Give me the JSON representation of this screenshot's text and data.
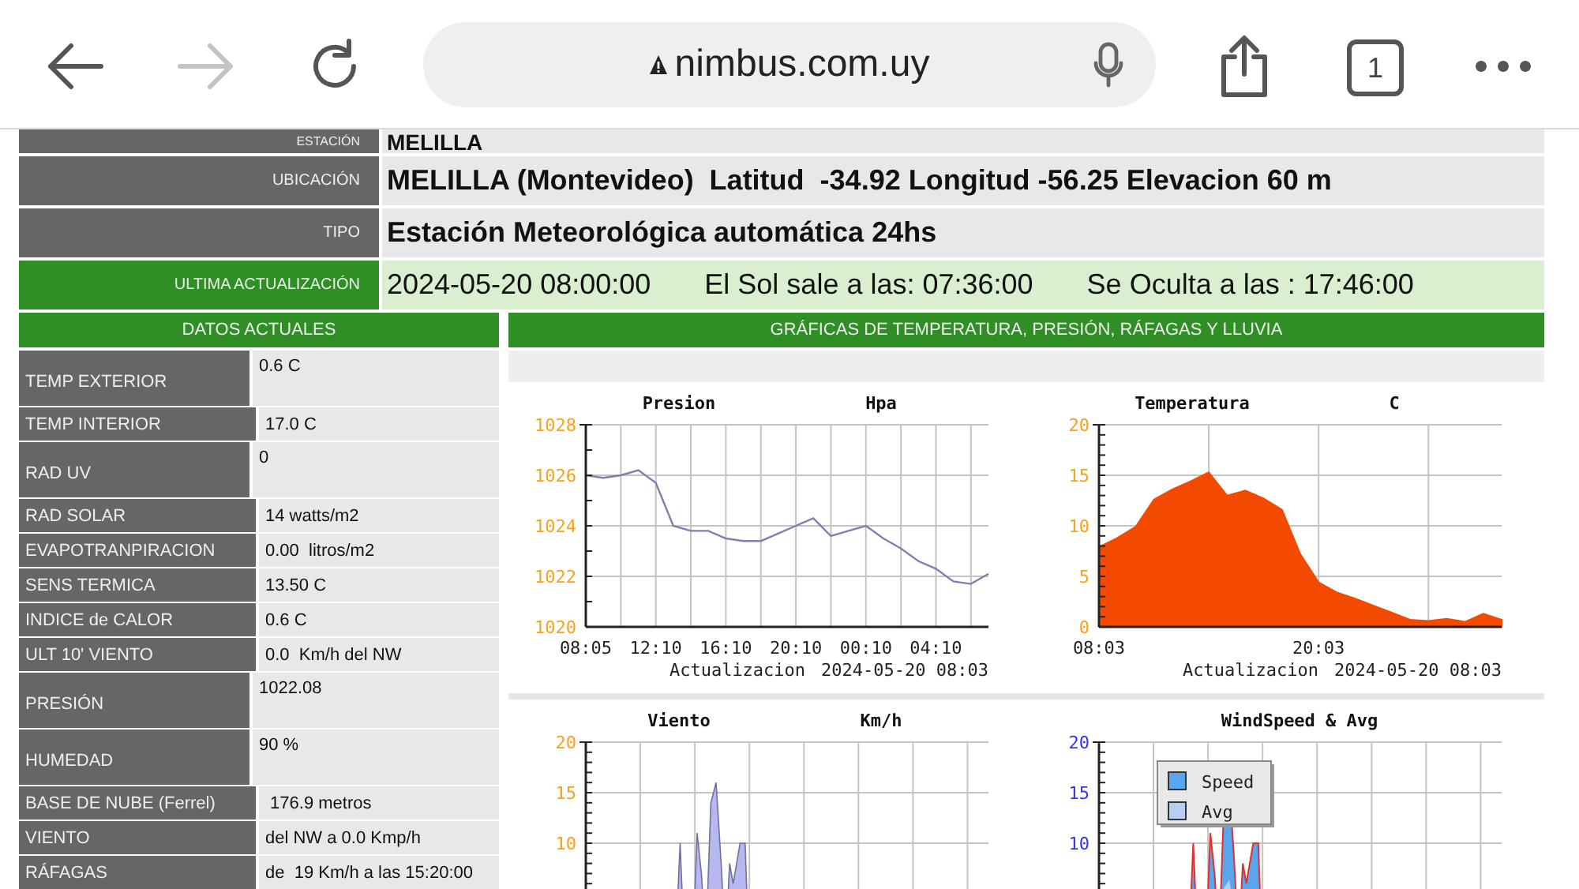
{
  "browser": {
    "url": "nimbus.com.uy",
    "tab_count": "1",
    "forward_disabled": true
  },
  "station_info": [
    {
      "label": "ESTACIÓN",
      "value": "MELILLA",
      "kind": "short"
    },
    {
      "label": "UBICACIÓN",
      "value": "MELILLA (Montevideo)  Latitud  -34.92 Longitud -56.25 Elevacion 60 m",
      "kind": "normal"
    },
    {
      "label": "TIPO",
      "value": "Estación Meteorológica automática 24hs",
      "kind": "normal"
    }
  ],
  "update": {
    "label": "ULTIMA ACTUALIZACIÓN",
    "date": "2024-05-20 08:00:00",
    "sunrise": "El Sol sale a las: 07:36:00",
    "sunset": "Se Oculta a las : 17:46:00"
  },
  "current": {
    "title": "DATOS ACTUALES",
    "rows": [
      {
        "label": "TEMP EXTERIOR",
        "value": "0.6 C",
        "kind": "tall"
      },
      {
        "label": "TEMP INTERIOR",
        "value": "17.0 C",
        "kind": "short"
      },
      {
        "label": "RAD UV",
        "value": "0",
        "kind": "tall"
      },
      {
        "label": "RAD SOLAR",
        "value": "14 watts/m2",
        "kind": "short"
      },
      {
        "label": "EVAPOTRANPIRACION",
        "value": "0.00  litros/m2",
        "kind": "short"
      },
      {
        "label": "SENS TERMICA",
        "value": "13.50 C",
        "kind": "short"
      },
      {
        "label": "INDICE de CALOR",
        "value": "0.6 C",
        "kind": "short"
      },
      {
        "label": "ULT 10' VIENTO",
        "value": "0.0  Km/h del NW",
        "kind": "short"
      },
      {
        "label": "PRESIÓN",
        "value": "1022.08",
        "kind": "tall"
      },
      {
        "label": "HUMEDAD",
        "value": "90 %",
        "kind": "tall"
      },
      {
        "label": "BASE DE NUBE (Ferrel)",
        "value": " 176.9 metros",
        "kind": "short"
      },
      {
        "label": "VIENTO",
        "value": "del NW a 0.0 Kmp/h",
        "kind": "short"
      },
      {
        "label": "RÁFAGAS",
        "value": "de  19 Km/h a las 15:20:00",
        "kind": "short"
      }
    ]
  },
  "graphs": {
    "title": "GRÁFICAS DE TEMPERATURA, PRESIÓN, RÁFAGAS Y LLUVIA",
    "charts": [
      {
        "unit": "Hpa",
        "color": "#f7a21b",
        "update_label": "Actualizacion",
        "update_time": "2024-05-20 08:03",
        "chart_data": {
          "type": "line",
          "title": "Presion",
          "grid": true,
          "ylim": [
            1020,
            1028
          ],
          "yticks": [
            1020,
            1022,
            1024,
            1026,
            1028
          ],
          "categories": [
            "08:05",
            null,
            null,
            null,
            "12:10",
            null,
            null,
            null,
            "16:10",
            null,
            null,
            null,
            "20:10",
            null,
            null,
            null,
            "00:10",
            null,
            null,
            null,
            "04:10",
            null,
            null,
            null
          ],
          "series": [
            {
              "color": "#8080b0",
              "values": [
                1026.0,
                1025.9,
                1026.0,
                1026.2,
                1025.7,
                1024.0,
                1023.8,
                1023.8,
                1023.5,
                1023.4,
                1023.4,
                1023.7,
                1024.0,
                1024.3,
                1023.6,
                1023.8,
                1024.0,
                1023.5,
                1023.1,
                1022.6,
                1022.3,
                1021.8,
                1021.7,
                1022.1
              ]
            }
          ]
        }
      },
      {
        "unit": "C",
        "color": "#f7a21b",
        "update_label": "Actualizacion",
        "update_time": "2024-05-20 08:03",
        "chart_data": {
          "type": "area",
          "title": "Temperatura",
          "grid": true,
          "ylim": [
            0,
            20
          ],
          "yticks": [
            0,
            5,
            10,
            15,
            20
          ],
          "categories": [
            "08:03",
            null,
            null,
            null,
            null,
            null,
            null,
            null,
            null,
            null,
            null,
            null,
            "20:03",
            null,
            null,
            null,
            null,
            null,
            null,
            null,
            null,
            null,
            null
          ],
          "series": [
            {
              "color": "#f44a00",
              "values": [
                7.9,
                8.8,
                9.9,
                12.6,
                13.6,
                14.4,
                15.3,
                13.0,
                13.5,
                12.7,
                11.6,
                7.2,
                4.4,
                3.4,
                2.8,
                2.1,
                1.4,
                0.7,
                0.6,
                0.8,
                0.5,
                1.3,
                0.7
              ]
            }
          ]
        }
      },
      {
        "title": "Viento",
        "unit": "Km/h",
        "color": "#f7a21b",
        "y_labels": [
          "20",
          "15",
          "10"
        ]
      },
      {
        "title": "WindSpeed & Avg",
        "color": "#3333ee",
        "y_labels": [
          "20",
          "15",
          "10"
        ],
        "legend": [
          {
            "label": "Speed",
            "color": "#5aa6ee"
          },
          {
            "label": "Avg",
            "color": "#b8cdf5"
          }
        ]
      }
    ]
  }
}
